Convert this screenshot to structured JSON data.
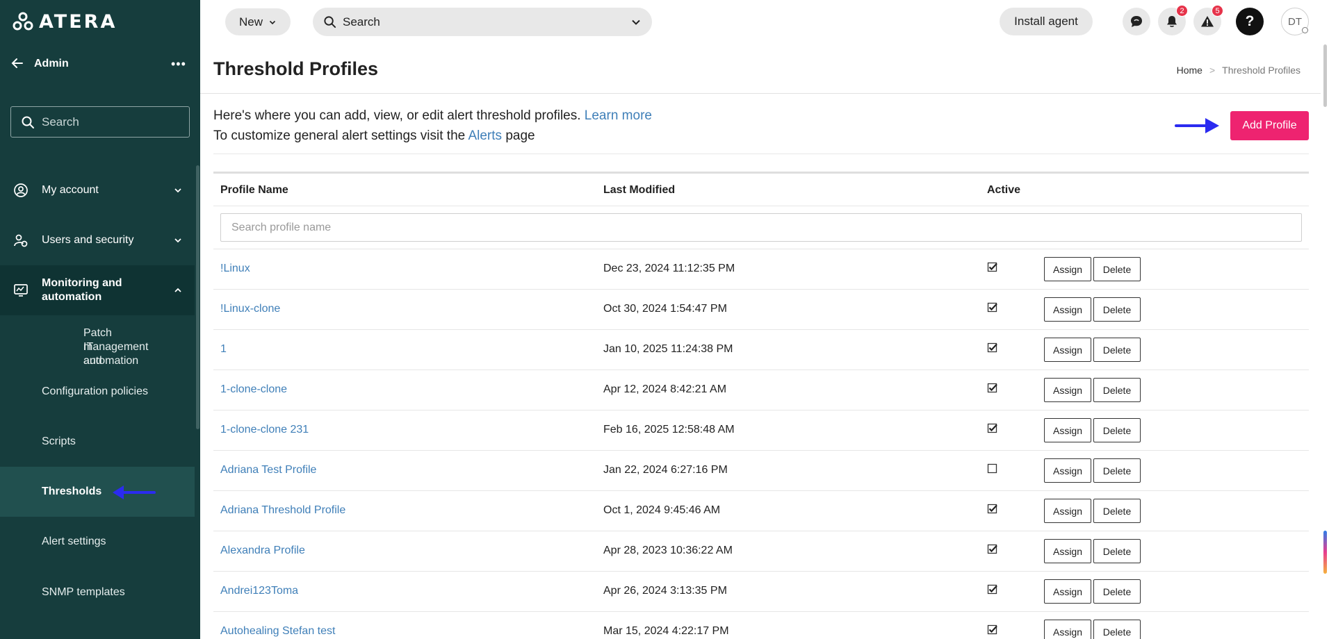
{
  "app": {
    "logo_text": "ATERA"
  },
  "sidebar": {
    "admin_label": "Admin",
    "more_label": "•••",
    "search_placeholder": "Search",
    "groups": [
      {
        "label": "My account"
      },
      {
        "label": "Users and security"
      },
      {
        "label_line1": "Monitoring and",
        "label_line2": "automation"
      }
    ],
    "sub_items": [
      {
        "line1": "Patch management and",
        "line2": "IT automation"
      },
      {
        "label": "Configuration policies"
      },
      {
        "label": "Scripts"
      },
      {
        "label": "Thresholds"
      },
      {
        "label": "Alert settings"
      },
      {
        "label": "SNMP templates"
      }
    ]
  },
  "topbar": {
    "new_label": "New",
    "search_placeholder": "Search",
    "install_label": "Install agent",
    "notifications_count": "2",
    "alerts_count": "5",
    "help_label": "?",
    "avatar_initials": "DT"
  },
  "page": {
    "title": "Threshold Profiles",
    "breadcrumb_home": "Home",
    "breadcrumb_sep": ">",
    "breadcrumb_current": "Threshold Profiles",
    "intro_line1": "Here's where you can add, view, or edit alert threshold profiles.",
    "learn_more": "Learn more",
    "intro_line2_pre": "To customize general alert settings visit the",
    "alerts_link": "Alerts",
    "intro_line2_post": "page",
    "add_profile_label": "Add Profile"
  },
  "table": {
    "headers": {
      "name": "Profile Name",
      "modified": "Last Modified",
      "active": "Active"
    },
    "filter_placeholder": "Search profile name",
    "assign_label": "Assign",
    "delete_label": "Delete",
    "rows": [
      {
        "name": "!Linux",
        "modified": "Dec 23, 2024 11:12:35 PM",
        "active": true
      },
      {
        "name": "!Linux-clone",
        "modified": "Oct 30, 2024 1:54:47 PM",
        "active": true
      },
      {
        "name": "1",
        "modified": "Jan 10, 2025 11:24:38 PM",
        "active": true
      },
      {
        "name": "1-clone-clone",
        "modified": "Apr 12, 2024 8:42:21 AM",
        "active": true
      },
      {
        "name": "1-clone-clone 231",
        "modified": "Feb 16, 2025 12:58:48 AM",
        "active": true
      },
      {
        "name": "Adriana Test Profile",
        "modified": "Jan 22, 2024 6:27:16 PM",
        "active": false
      },
      {
        "name": "Adriana Threshold Profile",
        "modified": "Oct 1, 2024 9:45:46 AM",
        "active": true
      },
      {
        "name": "Alexandra Profile",
        "modified": "Apr 28, 2023 10:36:22 AM",
        "active": true
      },
      {
        "name": "Andrei123Toma",
        "modified": "Apr 26, 2024 3:13:35 PM",
        "active": true
      },
      {
        "name": "Autohealing Stefan test",
        "modified": "Mar 15, 2024 4:22:17 PM",
        "active": true
      }
    ]
  },
  "colors": {
    "sidebar_bg": "#163d3d",
    "accent_pink": "#ee2370",
    "link_blue": "#3f7fb8",
    "annotation_arrow": "#2b2bf0"
  }
}
